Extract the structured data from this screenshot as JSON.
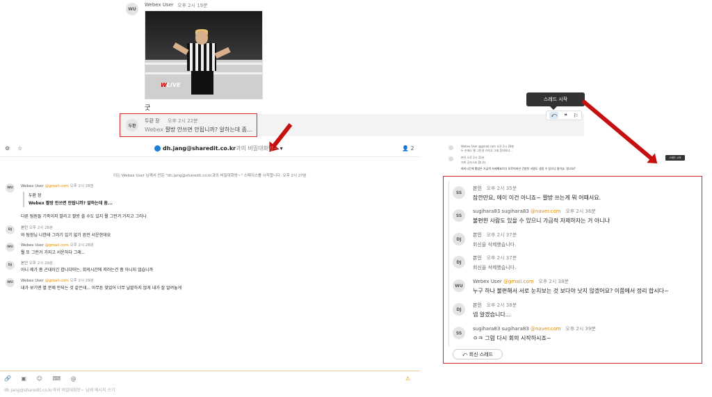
{
  "top": {
    "sender_initials": "WU",
    "sender_name": "Webex User",
    "time": "오후 2시 19분",
    "gif_logo": "LIVE",
    "reply_text": "굿",
    "quote_initials": "두환",
    "quote_name": "두환 장",
    "quote_time": "오후 2시 22분",
    "quote_prefix": "Webex",
    "quote_text": " 짤방 안쓰면 안됩니까? 알하는데 좀...",
    "tooltip": "스레드 시작",
    "actions": [
      "⤺",
      "❝",
      "⚐"
    ]
  },
  "left": {
    "header": {
      "icon_left1": "⚙",
      "icon_left2": "☆",
      "title_main": "dh.jang@sharedit.co.kr",
      "title_rest": "과의 비밀대화방~",
      "people_count": "2"
    },
    "system_message": "이는 Webex User 님께서 만든 \"dh.jang@sharedit.co.kr과의 비밀대화방~\" 스페이스를 시작합니다. 오후 2시 27분",
    "messages": [
      {
        "initials": "WU",
        "name": "Webex User",
        "mail": "@gmail.com",
        "time": "오후 2시 28분"
      },
      {
        "initials": "DJ",
        "name": "본인",
        "mail": "",
        "time": "오후 2시 28분"
      },
      {
        "initials": "WU",
        "name": "Webex User",
        "mail": "@gmail.com",
        "time": "오후 2시 28분"
      },
      {
        "initials": "DJ",
        "name": "본인",
        "mail": "",
        "time": "오후 2시 29분"
      },
      {
        "initials": "WU",
        "name": "Webex User",
        "mail": "@gmail.com",
        "time": "오후 2시 29분"
      }
    ],
    "quote_name": "두환 장",
    "quote_text": "Webex 짤방 안쓰면 안됩니까? 알하는데 좀...",
    "texts": [
      "다른 팀원들 기죽이지 말라고 짤방 쓸 수도 있지 뭘 그런거 가지고 그러나",
      "와 팀장님 나한테 그러기 있기 없기 완전 서운한데요",
      "뭘 또 그런거 가지고 서운하다 그래...",
      "아니 제가 좀 곤대이긴 합니다마는, 회의시간에 저러는건 좀 아니지 않습니까",
      "내가 보기엔 별 문제 안되는 것 같은데... 아무튼 맞었어 너무 날밭하지 않게 내가 잘 알려놓게"
    ],
    "composer_icons": "🔗 ▣ ☺ ⌨ @",
    "composer_placeholder": "dh.jang@sharedit.co.kr과의 비밀대화방~ 님께 메시지 쓰기",
    "composer_right": "⚠"
  },
  "mini": {
    "line1": "Webex User @gmail.com 오후 2시 28분",
    "line2": "두 손에도 짤 그린걸 가지고 그래 혼대하냐...",
    "line3": "본인 오후 2시 31분",
    "line4": "저희 공자시죠 합니다.",
    "line5": "회의시간에 짤방은 가급적 자제해요이다 모르어떠선 건방한 서말도 생길 수 있으니 말이죠. 말고요?",
    "tooltip": "스레드 시작"
  },
  "thread": {
    "messages": [
      {
        "initials": "SS",
        "name": "본인",
        "mail": "",
        "time": "오후 2시 35분",
        "text": "잠깐만요, 에이 이건 아니죠~ 짤방 쓰는게 뭐 어때서요."
      },
      {
        "initials": "SS",
        "name": "sugihara83 sugihara83",
        "mail": "@naver.com",
        "time": "오후 2시 36분",
        "text": "불편한 사람도 있을 수 있으니 가급적 자제하자는 거 아니냐"
      },
      {
        "initials": "DJ",
        "name": "본인",
        "mail": "",
        "time": "오후 2시 37분",
        "text": "회신을 삭제했습니다."
      },
      {
        "initials": "DJ",
        "name": "본인",
        "mail": "",
        "time": "오후 2시 37분",
        "text": "회신을 삭제했습니다."
      },
      {
        "initials": "WU",
        "name": "Webex User",
        "mail": "@gmail.com",
        "time": "오후 2시 38분",
        "text": "누구 하나 불편해서 서로 눈치보는 것 보다야 낫지 않겠어요? 이쯤에서 정리 합시다~"
      },
      {
        "initials": "DJ",
        "name": "본인",
        "mail": "",
        "time": "오후 2시 38분",
        "text": "넵 알겠습니다..."
      },
      {
        "initials": "SS",
        "name": "sugihara83 sugihara83",
        "mail": "@naver.com",
        "time": "오후 2시 39분",
        "text": "ㅇㅋ 그럼 다시 회의 시작하시죠~"
      }
    ],
    "reply_button": "⤺ 회신 스레드"
  }
}
